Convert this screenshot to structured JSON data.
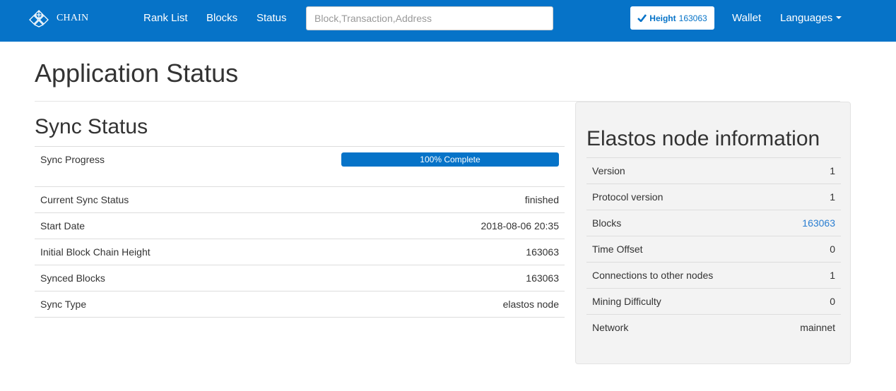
{
  "nav": {
    "brand": "CHAIN",
    "links": [
      "Rank List",
      "Blocks",
      "Status"
    ],
    "search_placeholder": "Block,Transaction,Address",
    "height_label": "Height",
    "height_value": "163063",
    "wallet": "Wallet",
    "languages": "Languages"
  },
  "page": {
    "title": "Application Status"
  },
  "sync": {
    "title": "Sync Status",
    "progress_label": "Sync Progress",
    "progress_percent": 100,
    "progress_text": "100% Complete",
    "rows": [
      {
        "label": "Current Sync Status",
        "value": "finished"
      },
      {
        "label": "Start Date",
        "value": "2018-08-06 20:35"
      },
      {
        "label": "Initial Block Chain Height",
        "value": "163063"
      },
      {
        "label": "Synced Blocks",
        "value": "163063"
      },
      {
        "label": "Sync Type",
        "value": "elastos node"
      }
    ]
  },
  "node": {
    "title": "Elastos node information",
    "rows": [
      {
        "label": "Version",
        "value": "1"
      },
      {
        "label": "Protocol version",
        "value": "1"
      },
      {
        "label": "Blocks",
        "value": "163063"
      },
      {
        "label": "Time Offset",
        "value": "0"
      },
      {
        "label": "Connections to other nodes",
        "value": "1"
      },
      {
        "label": "Mining Difficulty",
        "value": "0"
      },
      {
        "label": "Network",
        "value": "mainnet"
      }
    ]
  },
  "colors": {
    "brand_blue": "#0673c8",
    "link_blue": "#2a7ed1",
    "panel_bg": "#f3f3f3"
  },
  "icons": {
    "logo": "chain-logo-icon",
    "check": "check-icon",
    "dropdown": "caret-down-icon"
  }
}
